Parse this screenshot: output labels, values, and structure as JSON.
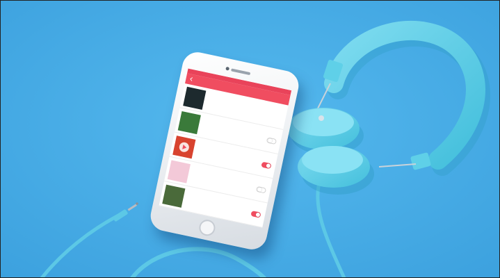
{
  "scene": {
    "background_color": "#45aee7",
    "accent_color": "#f04d60",
    "headphone_color": "#5fd0e8",
    "cable_color": "#5cc8e6"
  },
  "phone": {
    "status_time": "",
    "nav_title": "",
    "items": [
      {
        "title": "",
        "line2": "",
        "line3": "",
        "toggle": "none",
        "cover_color": "#1d2a2e"
      },
      {
        "title": "",
        "line2": "",
        "line3": "",
        "toggle": "off",
        "cover_color": "#3a7a3a"
      },
      {
        "title": "",
        "line2": "",
        "line3": "",
        "toggle": "on",
        "cover_color": "#d8432f"
      },
      {
        "title": "",
        "line2": "",
        "line3": "",
        "toggle": "off",
        "cover_color": "#f3c9d8"
      },
      {
        "title": "",
        "line2": "",
        "line3": "",
        "toggle": "on",
        "cover_color": "#4a6a3a"
      }
    ]
  }
}
